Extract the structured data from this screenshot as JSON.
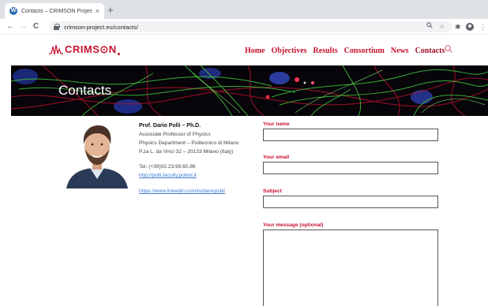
{
  "browser": {
    "tab_title": "Contacts – CRIMSON Project",
    "tab_close": "×",
    "new_tab": "+",
    "url": "crimson-project.eu/contacts/",
    "back": "←",
    "forward": "→",
    "reload": "C",
    "favicon": "W",
    "icons": [
      "back-icon",
      "forward-icon",
      "reload-icon",
      "lock-icon",
      "zoom-icon",
      "star-icon",
      "puzzle-icon",
      "profile-icon",
      "menu-icon"
    ]
  },
  "site": {
    "logo": "CRIMS⊙N",
    "nav": [
      "Home",
      "Objectives",
      "Results",
      "Consortium",
      "News",
      "Contacts"
    ],
    "active_nav": "Contacts",
    "brand_color": "#c8102e"
  },
  "hero": {
    "title": "Contacts"
  },
  "person": {
    "name": "Prof. Dario Polli – Ph.D.",
    "role": "Associate Professor of Physics",
    "department": "Physics Department – Politecnico di Milano",
    "address": "P.za L. da Vinci 32 – 20133 Milano (Italy)",
    "tel": "Tel: (+39)02.23.99.60.86",
    "website": "http://polli.faculty.polimi.it",
    "linkedin": "https://www.linkedin.com/in/dariopolli/"
  },
  "form": {
    "name_label": "Your name",
    "email_label": "Your email",
    "subject_label": "Subject",
    "message_label": "Your message (optional)",
    "name_value": "",
    "email_value": "",
    "subject_value": "",
    "message_value": ""
  }
}
